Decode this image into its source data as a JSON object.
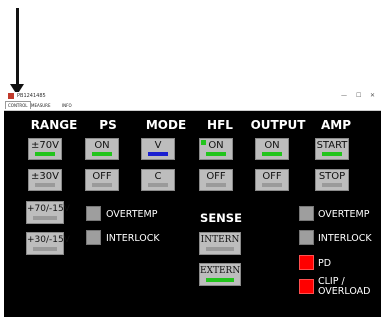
{
  "window": {
    "title": "PB1241485",
    "minimize": "—",
    "maximize": "☐",
    "close": "✕"
  },
  "tabs": [
    {
      "label": "CONTROL"
    },
    {
      "label": "MEASURE"
    },
    {
      "label": "INFO"
    }
  ],
  "headers": {
    "range": "RANGE",
    "ps": "PS",
    "mode": "MODE",
    "hfl": "HFL",
    "output": "OUTPUT",
    "amp": "AMP",
    "sense": "SENSE"
  },
  "range": {
    "plus70": "±70V",
    "plus30": "±30V",
    "p70m15": "+70/-15V",
    "p30m15": "+30/-15V"
  },
  "ps": {
    "on": "ON",
    "off": "OFF"
  },
  "mode": {
    "v": "V",
    "c": "C"
  },
  "hfl": {
    "on": "ON",
    "off": "OFF"
  },
  "output": {
    "on": "ON",
    "off": "OFF"
  },
  "amp": {
    "start": "START",
    "stop": "STOP"
  },
  "sense": {
    "intern": "INTERN",
    "extern": "EXTERN"
  },
  "ps_status": {
    "overtemp": "OVERTEMP",
    "interlock": "INTERLOCK"
  },
  "amp_status": {
    "overtemp": "OVERTEMP",
    "interlock": "INTERLOCK",
    "pd": "PD",
    "clip_line1": "CLIP /",
    "clip_line2": "OVERLOAD"
  },
  "colors": {
    "active_indicator": "#22c41c",
    "mode_indicator": "#1a1fd0",
    "fault_indicator": "#ff0000",
    "panel_bg": "#000000"
  }
}
